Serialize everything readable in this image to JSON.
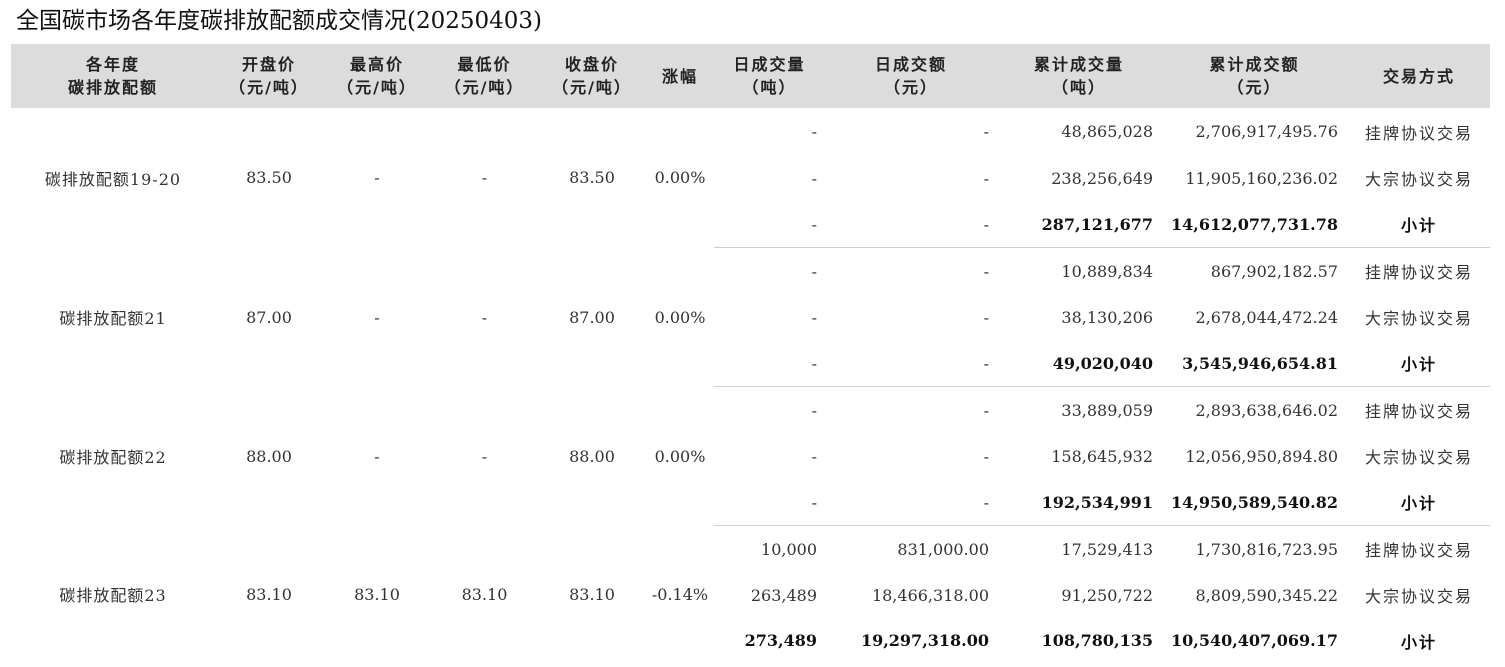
{
  "title": "全国碳市场各年度碳排放配额成交情况(20250403)",
  "headers": [
    {
      "l1": "各年度",
      "l2": "碳排放配额"
    },
    {
      "l1": "开盘价",
      "l2": "（元/吨）"
    },
    {
      "l1": "最高价",
      "l2": "（元/吨）"
    },
    {
      "l1": "最低价",
      "l2": "（元/吨）"
    },
    {
      "l1": "收盘价",
      "l2": "（元/吨）"
    },
    {
      "l1": "涨幅",
      "l2": ""
    },
    {
      "l1": "日成交量",
      "l2": "（吨）"
    },
    {
      "l1": "日成交额",
      "l2": "（元）"
    },
    {
      "l1": "累计成交量",
      "l2": "（吨）"
    },
    {
      "l1": "累计成交额",
      "l2": "（元）"
    },
    {
      "l1": "交易方式",
      "l2": ""
    }
  ],
  "groups": [
    {
      "name": "碳排放配额19-20",
      "open": "83.50",
      "high": "-",
      "low": "-",
      "close": "83.50",
      "change": "0.00%",
      "rows": [
        {
          "vol": "-",
          "amt": "-",
          "cumVol": "48,865,028",
          "cumAmt": "2,706,917,495.76",
          "method": "挂牌协议交易"
        },
        {
          "vol": "-",
          "amt": "-",
          "cumVol": "238,256,649",
          "cumAmt": "11,905,160,236.02",
          "method": "大宗协议交易"
        },
        {
          "vol": "-",
          "amt": "-",
          "cumVol": "287,121,677",
          "cumAmt": "14,612,077,731.78",
          "method": "小计"
        }
      ]
    },
    {
      "name": "碳排放配额21",
      "open": "87.00",
      "high": "-",
      "low": "-",
      "close": "87.00",
      "change": "0.00%",
      "rows": [
        {
          "vol": "-",
          "amt": "-",
          "cumVol": "10,889,834",
          "cumAmt": "867,902,182.57",
          "method": "挂牌协议交易"
        },
        {
          "vol": "-",
          "amt": "-",
          "cumVol": "38,130,206",
          "cumAmt": "2,678,044,472.24",
          "method": "大宗协议交易"
        },
        {
          "vol": "-",
          "amt": "-",
          "cumVol": "49,020,040",
          "cumAmt": "3,545,946,654.81",
          "method": "小计"
        }
      ]
    },
    {
      "name": "碳排放配额22",
      "open": "88.00",
      "high": "-",
      "low": "-",
      "close": "88.00",
      "change": "0.00%",
      "rows": [
        {
          "vol": "-",
          "amt": "-",
          "cumVol": "33,889,059",
          "cumAmt": "2,893,638,646.02",
          "method": "挂牌协议交易"
        },
        {
          "vol": "-",
          "amt": "-",
          "cumVol": "158,645,932",
          "cumAmt": "12,056,950,894.80",
          "method": "大宗协议交易"
        },
        {
          "vol": "-",
          "amt": "-",
          "cumVol": "192,534,991",
          "cumAmt": "14,950,589,540.82",
          "method": "小计"
        }
      ]
    },
    {
      "name": "碳排放配额23",
      "open": "83.10",
      "high": "83.10",
      "low": "83.10",
      "close": "83.10",
      "change": "-0.14%",
      "rows": [
        {
          "vol": "10,000",
          "amt": "831,000.00",
          "cumVol": "17,529,413",
          "cumAmt": "1,730,816,723.95",
          "method": "挂牌协议交易"
        },
        {
          "vol": "263,489",
          "amt": "18,466,318.00",
          "cumVol": "91,250,722",
          "cumAmt": "8,809,590,345.22",
          "method": "大宗协议交易"
        },
        {
          "vol": "273,489",
          "amt": "19,297,318.00",
          "cumVol": "108,780,135",
          "cumAmt": "10,540,407,069.17",
          "method": "小计"
        }
      ]
    }
  ]
}
